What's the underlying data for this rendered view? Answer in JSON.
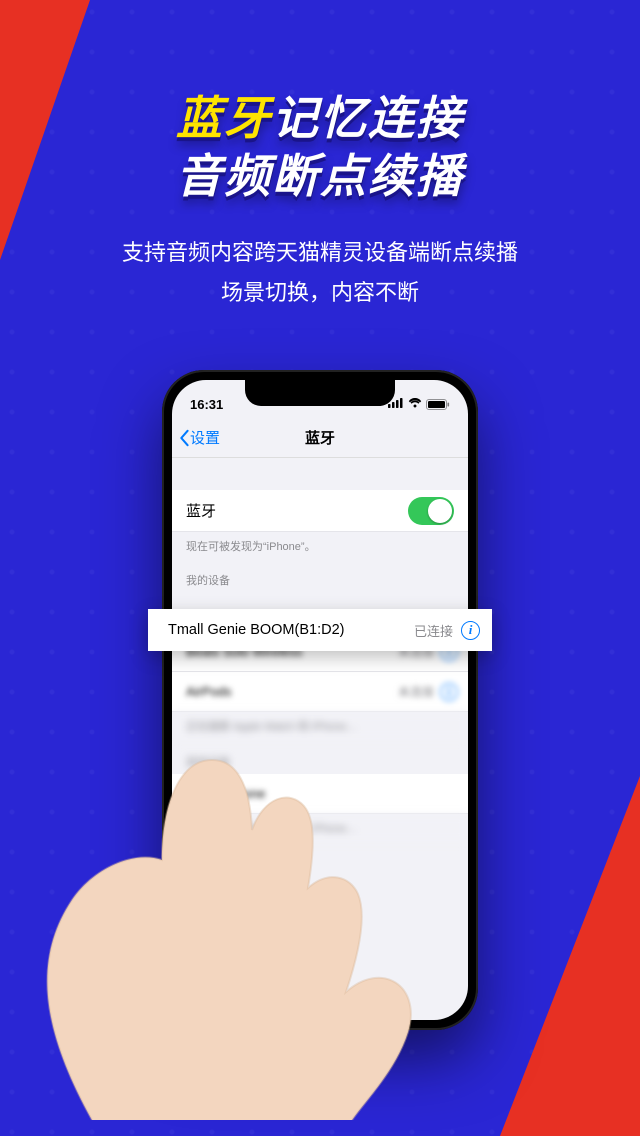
{
  "promo": {
    "headline_l1a": "蓝牙",
    "headline_l1b": "记忆连接",
    "headline_l2a": "音频",
    "headline_l2b": "断点续播",
    "sub_l1": "支持音频内容跨天猫精灵设备端断点续播",
    "sub_l2": "场景切换，内容不断"
  },
  "statusbar": {
    "time": "16:31"
  },
  "nav": {
    "back_label": "设置",
    "title": "蓝牙"
  },
  "bluetooth": {
    "row_label": "蓝牙",
    "discoverable_note": "现在可被发现为“iPhone”。",
    "my_devices_header": "我的设备",
    "connected_label": "已连接",
    "not_connected_label": "未连接",
    "other_devices_header": "其他设备"
  },
  "highlight_device": {
    "name": "Tmall Genie BOOM(B1:D2)",
    "status": "已连接"
  },
  "blurred_devices": [
    {
      "name": "Beats Solo Wireless",
      "status": "未连接"
    },
    {
      "name": "AirPods",
      "status": "未连接"
    }
  ],
  "blurred_other": {
    "device": "Mobile Phone",
    "note": "正在搜索 Apple Watch 和 iPhone…"
  }
}
